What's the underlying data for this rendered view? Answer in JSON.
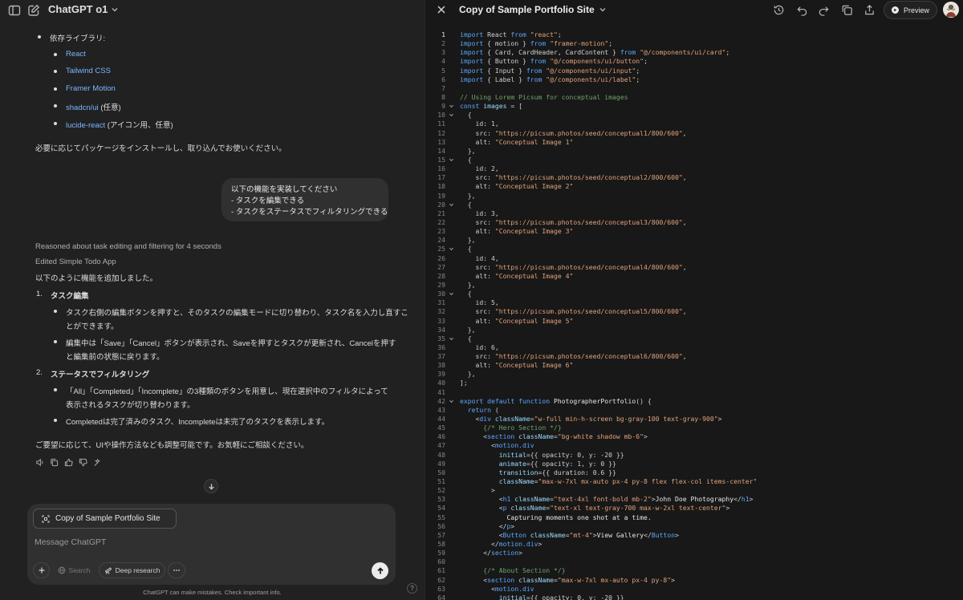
{
  "app": {
    "model_name": "ChatGPT o1"
  },
  "chat": {
    "deps_heading": "依存ライブラリ:",
    "deps": [
      {
        "label": "React",
        "note": ""
      },
      {
        "label": "Tailwind CSS",
        "note": ""
      },
      {
        "label": "Framer Motion",
        "note": ""
      },
      {
        "label": "shadcn/ui",
        "note": "(任意)"
      },
      {
        "label": "lucide-react",
        "note": "(アイコン用、任意)"
      }
    ],
    "install_note": "必要に応じてパッケージをインストールし、取り込んでお使いください。",
    "user_message": [
      "以下の機能を実装してください",
      "- タスクを編集できる",
      "- タスクをステータスでフィルタリングできる"
    ],
    "reasoning": "Reasoned about task editing and filtering for 4 seconds",
    "edited_canvas": "Edited Simple Todo App",
    "intro": "以下のように機能を追加しました。",
    "sections": [
      {
        "number": "1.",
        "title": "タスク編集",
        "bullets": [
          [
            "タスク右側の編集ボタンを押すと、そのタスクの編集モードに切り替わり、タスク名を入力し直すこ",
            "とができます。"
          ],
          [
            "編集中は「Save」「Cancel」ボタンが表示され、Saveを押すとタスクが更新され、Cancelを押す",
            "と編集前の状態に戻ります。"
          ]
        ]
      },
      {
        "number": "2.",
        "title": "ステータスでフィルタリング",
        "bullets": [
          [
            "「All」「Completed」「Incomplete」の3種類のボタンを用意し、現在選択中のフィルタによって",
            "表示されるタスクが切り替わります。"
          ],
          [
            "Completedは完了済みのタスク、Incompleteは未完了のタスクを表示します。"
          ]
        ]
      }
    ],
    "closing": "ご要望に応じて、UIや操作方法なども調整可能です。お気軽にご相談ください。"
  },
  "composer": {
    "canvas_chip": "Copy of Sample Portfolio Site",
    "placeholder": "Message ChatGPT",
    "search_label": "Search",
    "research_label": "Deep research"
  },
  "disclaimer": "ChatGPT can make mistakes. Check important info.",
  "canvas": {
    "title": "Copy of Sample Portfolio Site",
    "preview_label": "Preview",
    "code_lines": [
      [
        [
          "kw",
          "import "
        ],
        [
          "",
          "React "
        ],
        [
          "kw",
          "from "
        ],
        [
          "str",
          "\"react\""
        ],
        [
          "",
          ";"
        ]
      ],
      [
        [
          "kw",
          "import "
        ],
        [
          "",
          "{ motion } "
        ],
        [
          "kw",
          "from "
        ],
        [
          "str",
          "\"framer-motion\""
        ],
        [
          "",
          ";"
        ]
      ],
      [
        [
          "kw",
          "import "
        ],
        [
          "",
          "{ Card, CardHeader, CardContent } "
        ],
        [
          "kw",
          "from "
        ],
        [
          "str",
          "\"@/components/ui/card\""
        ],
        [
          "",
          ";"
        ]
      ],
      [
        [
          "kw",
          "import "
        ],
        [
          "",
          "{ Button } "
        ],
        [
          "kw",
          "from "
        ],
        [
          "str",
          "\"@/components/ui/button\""
        ],
        [
          "",
          ";"
        ]
      ],
      [
        [
          "kw",
          "import "
        ],
        [
          "",
          "{ Input } "
        ],
        [
          "kw",
          "from "
        ],
        [
          "str",
          "\"@/components/ui/input\""
        ],
        [
          "",
          ";"
        ]
      ],
      [
        [
          "kw",
          "import "
        ],
        [
          "",
          "{ Label } "
        ],
        [
          "kw",
          "from "
        ],
        [
          "str",
          "\"@/components/ui/label\""
        ],
        [
          "",
          ";"
        ]
      ],
      [],
      [
        [
          "com",
          "// Using Lorem Picsum for conceptual images"
        ]
      ],
      [
        [
          "kw",
          "const "
        ],
        [
          "attr",
          "images"
        ],
        [
          "",
          " = ["
        ]
      ],
      [
        [
          "",
          "  {"
        ]
      ],
      [
        [
          "",
          "    id: 1,"
        ]
      ],
      [
        [
          "",
          "    src: "
        ],
        [
          "str",
          "\"https://picsum.photos/seed/conceptual1/800/600\""
        ],
        [
          "",
          ","
        ]
      ],
      [
        [
          "",
          "    alt: "
        ],
        [
          "str",
          "\"Conceptual Image 1\""
        ]
      ],
      [
        [
          "",
          "  },"
        ]
      ],
      [
        [
          "",
          "  {"
        ]
      ],
      [
        [
          "",
          "    id: 2,"
        ]
      ],
      [
        [
          "",
          "    src: "
        ],
        [
          "str",
          "\"https://picsum.photos/seed/conceptual2/800/600\""
        ],
        [
          "",
          ","
        ]
      ],
      [
        [
          "",
          "    alt: "
        ],
        [
          "str",
          "\"Conceptual Image 2\""
        ]
      ],
      [
        [
          "",
          "  },"
        ]
      ],
      [
        [
          "",
          "  {"
        ]
      ],
      [
        [
          "",
          "    id: 3,"
        ]
      ],
      [
        [
          "",
          "    src: "
        ],
        [
          "str",
          "\"https://picsum.photos/seed/conceptual3/800/600\""
        ],
        [
          "",
          ","
        ]
      ],
      [
        [
          "",
          "    alt: "
        ],
        [
          "str",
          "\"Conceptual Image 3\""
        ]
      ],
      [
        [
          "",
          "  },"
        ]
      ],
      [
        [
          "",
          "  {"
        ]
      ],
      [
        [
          "",
          "    id: 4,"
        ]
      ],
      [
        [
          "",
          "    src: "
        ],
        [
          "str",
          "\"https://picsum.photos/seed/conceptual4/800/600\""
        ],
        [
          "",
          ","
        ]
      ],
      [
        [
          "",
          "    alt: "
        ],
        [
          "str",
          "\"Conceptual Image 4\""
        ]
      ],
      [
        [
          "",
          "  },"
        ]
      ],
      [
        [
          "",
          "  {"
        ]
      ],
      [
        [
          "",
          "    id: 5,"
        ]
      ],
      [
        [
          "",
          "    src: "
        ],
        [
          "str",
          "\"https://picsum.photos/seed/conceptual5/800/600\""
        ],
        [
          "",
          ","
        ]
      ],
      [
        [
          "",
          "    alt: "
        ],
        [
          "str",
          "\"Conceptual Image 5\""
        ]
      ],
      [
        [
          "",
          "  },"
        ]
      ],
      [
        [
          "",
          "  {"
        ]
      ],
      [
        [
          "",
          "    id: 6,"
        ]
      ],
      [
        [
          "",
          "    src: "
        ],
        [
          "str",
          "\"https://picsum.photos/seed/conceptual6/800/600\""
        ],
        [
          "",
          ","
        ]
      ],
      [
        [
          "",
          "    alt: "
        ],
        [
          "str",
          "\"Conceptual Image 6\""
        ]
      ],
      [
        [
          "",
          "  },"
        ]
      ],
      [
        [
          "",
          "];"
        ]
      ],
      [],
      [
        [
          "kw",
          "export default function "
        ],
        [
          "txt",
          "PhotographerPortfolio"
        ],
        [
          "",
          "() {"
        ]
      ],
      [
        [
          "kw",
          "  return "
        ],
        [
          "",
          "("
        ]
      ],
      [
        [
          "",
          "    <"
        ],
        [
          "tag",
          "div "
        ],
        [
          "attr",
          "className"
        ],
        [
          "",
          "="
        ],
        [
          "str",
          "\"w-full min-h-screen bg-gray-100 text-gray-900\""
        ],
        [
          "",
          ">"
        ]
      ],
      [
        [
          "com",
          "      {/* Hero Section */}"
        ]
      ],
      [
        [
          "",
          "      <"
        ],
        [
          "tag",
          "section "
        ],
        [
          "attr",
          "className"
        ],
        [
          "",
          "="
        ],
        [
          "str",
          "\"bg-white shadow mb-6\""
        ],
        [
          "",
          ">"
        ]
      ],
      [
        [
          "",
          "        <"
        ],
        [
          "tag",
          "motion.div"
        ]
      ],
      [
        [
          "attr",
          "          initial"
        ],
        [
          "",
          "={{ opacity: 0, y: -20 }}"
        ]
      ],
      [
        [
          "attr",
          "          animate"
        ],
        [
          "",
          "={{ opacity: 1, y: 0 }}"
        ]
      ],
      [
        [
          "attr",
          "          transition"
        ],
        [
          "",
          "={{ duration: 0.6 }}"
        ]
      ],
      [
        [
          "attr",
          "          className"
        ],
        [
          "",
          "="
        ],
        [
          "str",
          "\"max-w-7xl mx-auto px-4 py-8 flex flex-col items-center\""
        ]
      ],
      [
        [
          "",
          "        >"
        ]
      ],
      [
        [
          "",
          "          <"
        ],
        [
          "tag",
          "h1 "
        ],
        [
          "attr",
          "className"
        ],
        [
          "",
          "="
        ],
        [
          "str",
          "\"text-4xl font-bold mb-2\""
        ],
        [
          "",
          ">"
        ],
        [
          "txt",
          "John Doe Photography"
        ],
        [
          "",
          "</"
        ],
        [
          "tag",
          "h1"
        ],
        [
          "",
          ">"
        ]
      ],
      [
        [
          "",
          "          <"
        ],
        [
          "tag",
          "p "
        ],
        [
          "attr",
          "className"
        ],
        [
          "",
          "="
        ],
        [
          "str",
          "\"text-xl text-gray-700 max-w-2xl text-center\""
        ],
        [
          "",
          ">"
        ]
      ],
      [
        [
          "txt",
          "            Capturing moments one shot at a time."
        ]
      ],
      [
        [
          "",
          "          </"
        ],
        [
          "tag",
          "p"
        ],
        [
          "",
          ">"
        ]
      ],
      [
        [
          "",
          "          <"
        ],
        [
          "tag",
          "Button "
        ],
        [
          "attr",
          "className"
        ],
        [
          "",
          "="
        ],
        [
          "str",
          "\"mt-4\""
        ],
        [
          "",
          ">"
        ],
        [
          "txt",
          "View Gallery"
        ],
        [
          "",
          "</"
        ],
        [
          "tag",
          "Button"
        ],
        [
          "",
          ">"
        ]
      ],
      [
        [
          "",
          "        </"
        ],
        [
          "tag",
          "motion.div"
        ],
        [
          "",
          ">"
        ]
      ],
      [
        [
          "",
          "      </"
        ],
        [
          "tag",
          "section"
        ],
        [
          "",
          ">"
        ]
      ],
      [],
      [
        [
          "com",
          "      {/* About Section */}"
        ]
      ],
      [
        [
          "",
          "      <"
        ],
        [
          "tag",
          "section "
        ],
        [
          "attr",
          "className"
        ],
        [
          "",
          "="
        ],
        [
          "str",
          "\"max-w-7xl mx-auto px-4 py-8\""
        ],
        [
          "",
          ">"
        ]
      ],
      [
        [
          "",
          "        <"
        ],
        [
          "tag",
          "motion.div"
        ]
      ],
      [
        [
          "attr",
          "          initial"
        ],
        [
          "",
          "={{ opacity: 0, y: -20 }}"
        ]
      ]
    ]
  }
}
